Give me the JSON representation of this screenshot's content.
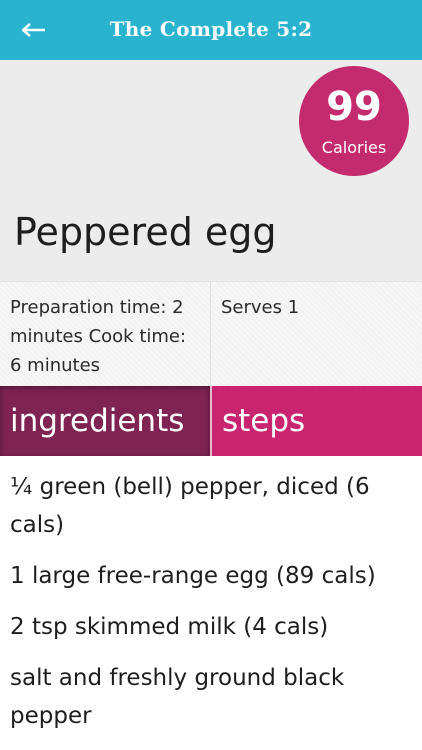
{
  "header": {
    "title": "The Complete 5:2",
    "back_icon": "arrow-left-icon"
  },
  "recipe": {
    "calories_value": "99",
    "calories_label": "Calories",
    "title": "Peppered egg",
    "times": "Preparation time: 2 minutes Cook time: 6 minutes",
    "serves": "Serves 1"
  },
  "tabs": [
    {
      "label": "ingredients",
      "active": true
    },
    {
      "label": "steps",
      "active": false
    }
  ],
  "ingredients": [
    "¼ green (bell) pepper, diced (6 cals)",
    "1 large free-range egg (89 cals)",
    "2 tsp skimmed milk (4 cals)",
    "salt and freshly ground black pepper"
  ],
  "colors": {
    "header": "#2ab3cf",
    "calorie_badge": "#c42a6e",
    "tab_active": "#7e2352",
    "tab_inactive": "#c8246f"
  }
}
